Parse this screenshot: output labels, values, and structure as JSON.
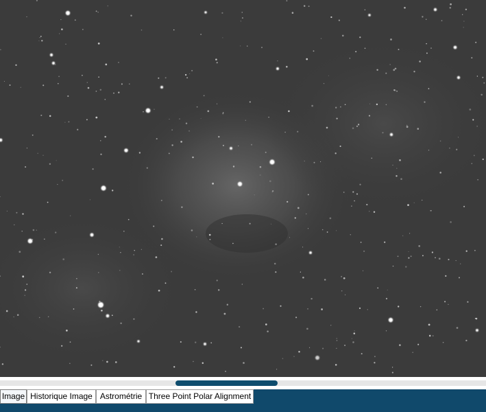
{
  "tabs": [
    {
      "label": "Image",
      "active": true
    },
    {
      "label": "Historique Image",
      "active": false
    },
    {
      "label": "Astrométrie",
      "active": false
    },
    {
      "label": "Three Point Polar Alignment",
      "active": false
    }
  ],
  "colors": {
    "image_background": "#3b3b3b",
    "tabbar_background": "#10496b",
    "scrollbar_thumb": "#0f4d6e",
    "scrollbar_track": "#e6e6e6"
  }
}
